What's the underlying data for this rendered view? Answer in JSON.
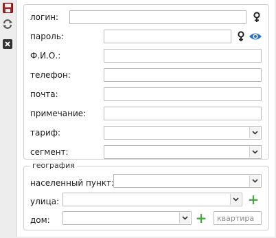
{
  "toolbar": {
    "save_icon": "save-icon",
    "refresh_icon": "refresh-icon",
    "close_icon": "close-icon"
  },
  "form": {
    "login_label": "логин:",
    "password_label": "пароль:",
    "fio_label": "Ф.И.О.:",
    "phone_label": "телефон:",
    "email_label": "почта:",
    "note_label": "примечание:",
    "tariff_label": "тариф:",
    "segment_label": "сегмент:",
    "login_value": "",
    "password_value": "",
    "fio_value": "",
    "phone_value": "",
    "email_value": "",
    "note_value": "",
    "tariff_value": "",
    "segment_value": ""
  },
  "geo": {
    "legend": "география",
    "locality_label": "населенный пункт:",
    "street_label": "улица:",
    "house_label": "дом:",
    "apartment_placeholder": "квартира",
    "locality_value": "",
    "street_value": "",
    "house_value": ""
  },
  "colors": {
    "add_icon": "#4aa843",
    "eye_icon": "#2a6fc9",
    "toolbar_save": "#a0282a"
  }
}
